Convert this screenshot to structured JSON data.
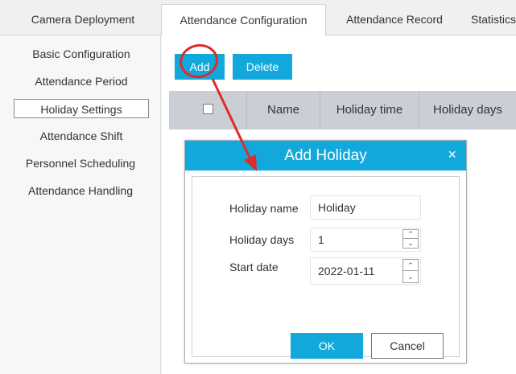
{
  "tabs": [
    "Camera Deployment",
    "Attendance Configuration",
    "Attendance Record",
    "Statistics"
  ],
  "sidebar": {
    "items": [
      "Basic Configuration",
      "Attendance Period",
      "Holiday Settings",
      "Attendance Shift",
      "Personnel Scheduling",
      "Attendance Handling"
    ]
  },
  "toolbar": {
    "add_label": "Add",
    "delete_label": "Delete"
  },
  "table": {
    "columns": [
      "Name",
      "Holiday time",
      "Holiday days"
    ]
  },
  "dialog": {
    "title": "Add Holiday",
    "close": "×",
    "holiday_name_label": "Holiday name",
    "holiday_name_value": "Holiday",
    "holiday_days_label": "Holiday days",
    "holiday_days_value": "1",
    "start_date_label": "Start date",
    "start_date_value": "2022-01-11",
    "ok_label": "OK",
    "cancel_label": "Cancel"
  },
  "colors": {
    "accent": "#12a8dc",
    "annotation": "#e02b2b",
    "header_gray": "#c9cfd4"
  }
}
